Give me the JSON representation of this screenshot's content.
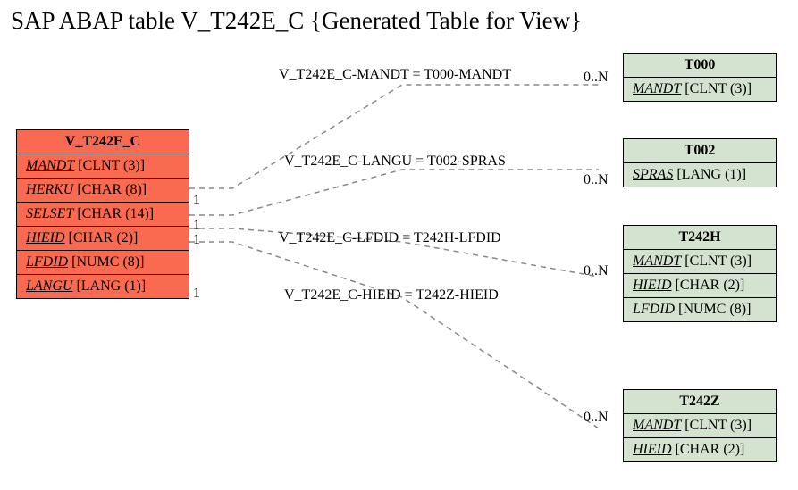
{
  "title": "SAP ABAP table V_T242E_C {Generated Table for View}",
  "main": {
    "name": "V_T242E_C",
    "fields": {
      "f0": {
        "name": "MANDT",
        "type": "[CLNT (3)]",
        "key": true
      },
      "f1": {
        "name": "HERKU",
        "type": "[CHAR (8)]",
        "key": false
      },
      "f2": {
        "name": "SELSET",
        "type": "[CHAR (14)]",
        "key": false
      },
      "f3": {
        "name": "HIEID",
        "type": "[CHAR (2)]",
        "key": true
      },
      "f4": {
        "name": "LFDID",
        "type": "[NUMC (8)]",
        "key": true
      },
      "f5": {
        "name": "LANGU",
        "type": "[LANG (1)]",
        "key": true
      }
    }
  },
  "refs": {
    "t000": {
      "name": "T000",
      "fields": {
        "f0": {
          "name": "MANDT",
          "type": "[CLNT (3)]",
          "key": true
        }
      }
    },
    "t002": {
      "name": "T002",
      "fields": {
        "f0": {
          "name": "SPRAS",
          "type": "[LANG (1)]",
          "key": true
        }
      }
    },
    "t242h": {
      "name": "T242H",
      "fields": {
        "f0": {
          "name": "MANDT",
          "type": "[CLNT (3)]",
          "key": true
        },
        "f1": {
          "name": "HIEID",
          "type": "[CHAR (2)]",
          "key": true
        },
        "f2": {
          "name": "LFDID",
          "type": "[NUMC (8)]",
          "key": false
        }
      }
    },
    "t242z": {
      "name": "T242Z",
      "fields": {
        "f0": {
          "name": "MANDT",
          "type": "[CLNT (3)]",
          "key": true
        },
        "f1": {
          "name": "HIEID",
          "type": "[CHAR (2)]",
          "key": true
        }
      }
    }
  },
  "rel": {
    "r1": {
      "label": "V_T242E_C-MANDT = T000-MANDT",
      "left": "1",
      "right": "0..N"
    },
    "r2": {
      "label": "V_T242E_C-LANGU = T002-SPRAS",
      "left": "1",
      "right": "0..N"
    },
    "r3": {
      "label": "V_T242E_C-LFDID = T242H-LFDID",
      "left": "1",
      "right": "0..N"
    },
    "r4": {
      "label": "V_T242E_C-HIEID = T242Z-HIEID",
      "left": "1",
      "right": "0..N"
    }
  }
}
